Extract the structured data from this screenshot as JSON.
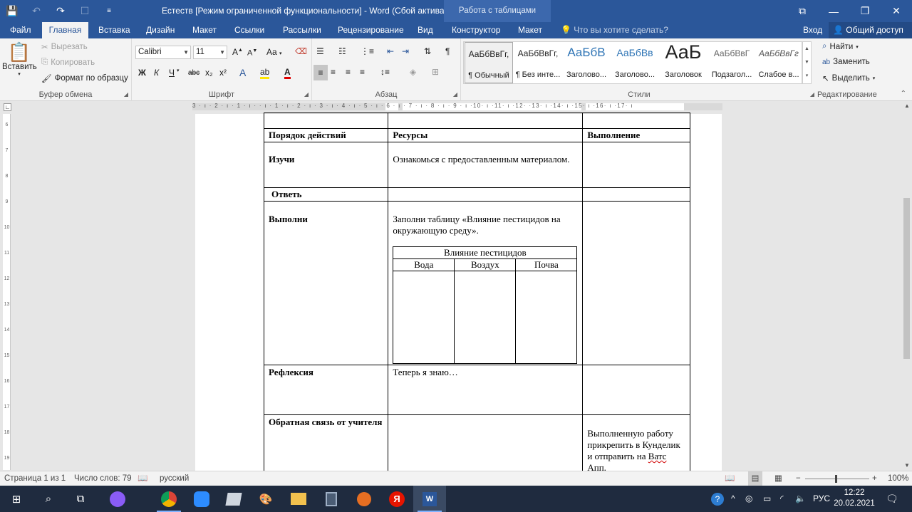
{
  "title_bar": {
    "document_title": "Естеств [Режим ограниченной функциональности] - Word (Сбой актива...",
    "context_tab_group": "Работа с таблицами"
  },
  "ribbon_tabs": [
    "Файл",
    "Главная",
    "Вставка",
    "Дизайн",
    "Макет",
    "Ссылки",
    "Рассылки",
    "Рецензирование",
    "Вид",
    "Конструктор",
    "Макет"
  ],
  "tell_me": "Что вы хотите сделать?",
  "account": {
    "sign_in": "Вход",
    "share": "Общий доступ"
  },
  "clipboard": {
    "paste": "Вставить",
    "cut": "Вырезать",
    "copy": "Копировать",
    "format_painter": "Формат по образцу",
    "label": "Буфер обмена"
  },
  "font": {
    "family": "Calibri",
    "size": "11",
    "grow": "A",
    "shrink": "A",
    "case": "Aa",
    "bold": "Ж",
    "italic": "К",
    "underline": "Ч",
    "strike": "abc",
    "subscript": "x₂",
    "superscript": "x²",
    "label": "Шрифт"
  },
  "paragraph": {
    "label": "Абзац",
    "pilcrow": "¶"
  },
  "styles": {
    "items": [
      {
        "sample": "АаБбВвГг,",
        "name": "¶ Обычный"
      },
      {
        "sample": "АаБбВвГг,",
        "name": "¶ Без инте..."
      },
      {
        "sample": "АаБбВ",
        "name": "Заголово..."
      },
      {
        "sample": "АаБбВв",
        "name": "Заголово..."
      },
      {
        "sample": "АаБ",
        "name": "Заголовок"
      },
      {
        "sample": "АаБбВвГ",
        "name": "Подзагол..."
      },
      {
        "sample": "АаБбВвГг",
        "name": "Слабое в..."
      }
    ],
    "label": "Стили"
  },
  "editing": {
    "find": "Найти",
    "replace": "Заменить",
    "select": "Выделить",
    "label": "Редактирование"
  },
  "ruler_h": "3 · ı · 2 · ı · 1 · ı ·   · ı · 1 · ı · 2 · ı · 3 · ı · 4 · ı · 5 · ı · 6 · ı · 7 · ı · 8 · ı · 9 · ı ·10· ı ·11· ı ·12·   ·13· ı ·14· ı ·15· ı ·16· ı ·17· ı",
  "ruler_v": [
    "6",
    "7",
    "8",
    "9",
    "10",
    "11",
    "12",
    "13",
    "14",
    "15",
    "16",
    "17",
    "18",
    "19"
  ],
  "document": {
    "headers": [
      "Порядок действий",
      "Ресурсы",
      "Выполнение"
    ],
    "row_study": {
      "step": "Изучи",
      "resource": "Ознакомься с предоставленным материалом."
    },
    "row_answer": {
      "step": "Ответь"
    },
    "row_do": {
      "step": "Выполни",
      "resource": "Заполни таблицу «Влияние пестицидов на окружающую среду»."
    },
    "inner_table": {
      "title": "Влияние пестицидов",
      "columns": [
        "Вода",
        "Воздух",
        "Почва"
      ]
    },
    "row_reflect": {
      "step": "Рефлексия",
      "resource": "Теперь я знаю…"
    },
    "row_feedback": {
      "step": "Обратная связь от учителя",
      "execution_pre": "Выполненную работу прикрепить в Кунделик и отправить на ",
      "execution_wavy": "Ватс Апп",
      "execution_post": "."
    }
  },
  "status_bar": {
    "page": "Страница 1 из 1",
    "words": "Число слов: 79",
    "language": "русский",
    "zoom": "100%"
  },
  "taskbar": {
    "lang": "РУС",
    "time": "12:22",
    "date": "20.02.2021"
  }
}
